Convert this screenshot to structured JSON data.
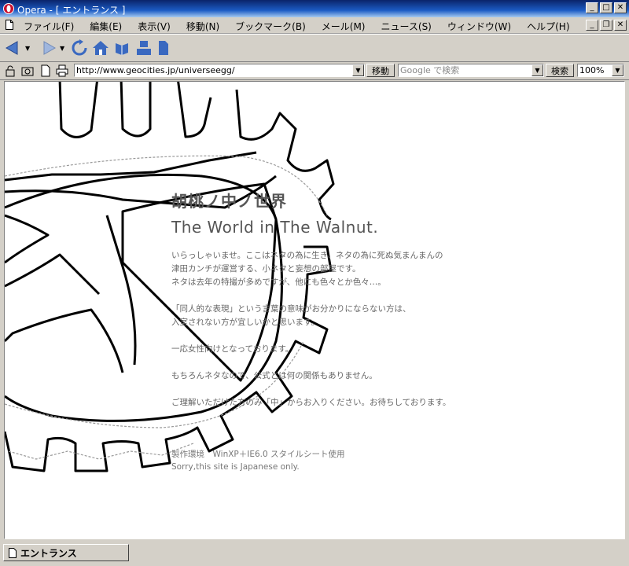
{
  "window": {
    "title": "Opera - [ エントランス ]"
  },
  "menu": {
    "items": [
      {
        "label": "ファイル(F)",
        "name": "menu-file"
      },
      {
        "label": "編集(E)",
        "name": "menu-edit"
      },
      {
        "label": "表示(V)",
        "name": "menu-view"
      },
      {
        "label": "移動(N)",
        "name": "menu-navigation"
      },
      {
        "label": "ブックマーク(B)",
        "name": "menu-bookmarks"
      },
      {
        "label": "メール(M)",
        "name": "menu-mail"
      },
      {
        "label": "ニュース(S)",
        "name": "menu-news"
      },
      {
        "label": "ウィンドウ(W)",
        "name": "menu-window"
      },
      {
        "label": "ヘルプ(H)",
        "name": "menu-help"
      }
    ]
  },
  "toolbar": {
    "icons": [
      "back-icon",
      "forward-icon",
      "reload-icon",
      "home-icon",
      "hotlist-icon",
      "print-icon",
      "page-icon"
    ]
  },
  "addressbar": {
    "url": "http://www.geocities.jp/universeegg/",
    "go_label": "移動",
    "search_placeholder": "Google で検索",
    "search_label": "検索",
    "zoom": "100%"
  },
  "page": {
    "title_jp": "胡桃ノ中ノ世界",
    "title_en": "The World in The Walnut.",
    "paragraphs": [
      [
        "いらっしゃいませ。ここはネタの為に生き、ネタの為に死ぬ気まんまんの",
        "津田カンチが運営する、小ネタと妄想の部屋です。",
        "ネタは去年の特撮が多めですが、他にも色々とか色々…。"
      ],
      [
        "「同人的な表現」という言葉の意味がお分かりにならない方は、",
        "入室されない方が宜しいかと思います。"
      ],
      [
        "一応女性向けとなっております。"
      ],
      [
        "もちろんネタなので、公式とは何の関係もありません。"
      ],
      [
        "ご理解いただけた方のみ「中」からお入りください。お待ちしております。"
      ]
    ],
    "footer_env": "製作環境　WinXP＋IE6.0 スタイルシート使用",
    "footer_note": "Sorry,this site is Japanese only."
  },
  "status": {
    "tab_label": "エントランス"
  }
}
